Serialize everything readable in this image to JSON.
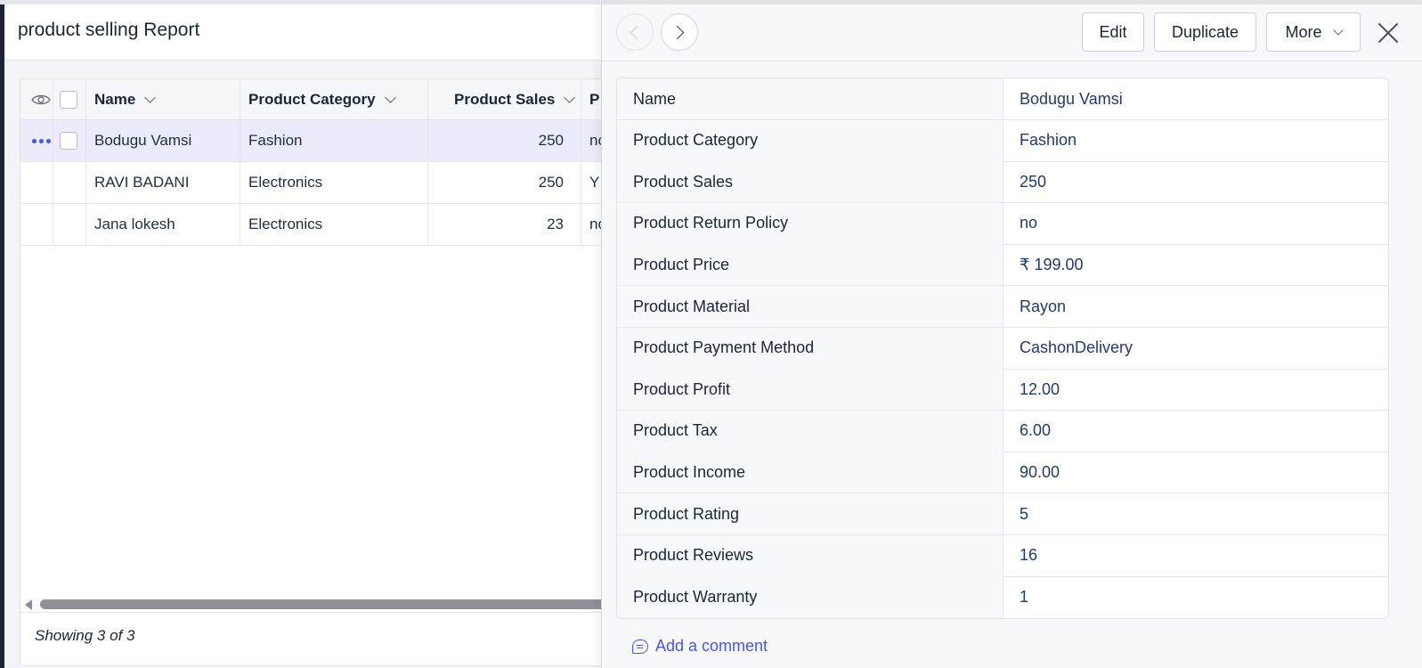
{
  "report": {
    "title": "product selling Report",
    "footer": "Showing 3 of 3"
  },
  "grid": {
    "columns": {
      "name": "Name",
      "category": "Product Category",
      "sales": "Product Sales",
      "partial": "P"
    },
    "rows": [
      {
        "name": "Bodugu Vamsi",
        "category": "Fashion",
        "sales": "250",
        "partial": "no"
      },
      {
        "name": "RAVI BADANI",
        "category": "Electronics",
        "sales": "250",
        "partial": "Y"
      },
      {
        "name": "Jana lokesh",
        "category": "Electronics",
        "sales": "23",
        "partial": "no"
      }
    ]
  },
  "drawer": {
    "buttons": {
      "edit": "Edit",
      "duplicate": "Duplicate",
      "more": "More"
    },
    "fields": [
      {
        "label": "Name",
        "value": "Bodugu Vamsi"
      },
      {
        "label": "Product Category",
        "value": "Fashion"
      },
      {
        "label": "Product Sales",
        "value": "250"
      },
      {
        "label": "Product Return Policy",
        "value": "no"
      },
      {
        "label": "Product Price",
        "value": "₹ 199.00"
      },
      {
        "label": "Product Material",
        "value": "Rayon"
      },
      {
        "label": "Product Payment Method",
        "value": "CashonDelivery"
      },
      {
        "label": "Product Profit",
        "value": "12.00"
      },
      {
        "label": "Product Tax",
        "value": "6.00"
      },
      {
        "label": "Product Income",
        "value": "90.00"
      },
      {
        "label": "Product Rating",
        "value": "5"
      },
      {
        "label": "Product Reviews",
        "value": "16"
      },
      {
        "label": "Product Warranty",
        "value": "1"
      }
    ],
    "add_comment": "Add a comment"
  },
  "colors": {
    "accent": "#4b55e0",
    "selected_row": "#ebebfb",
    "sidebar": "#1e2338"
  }
}
